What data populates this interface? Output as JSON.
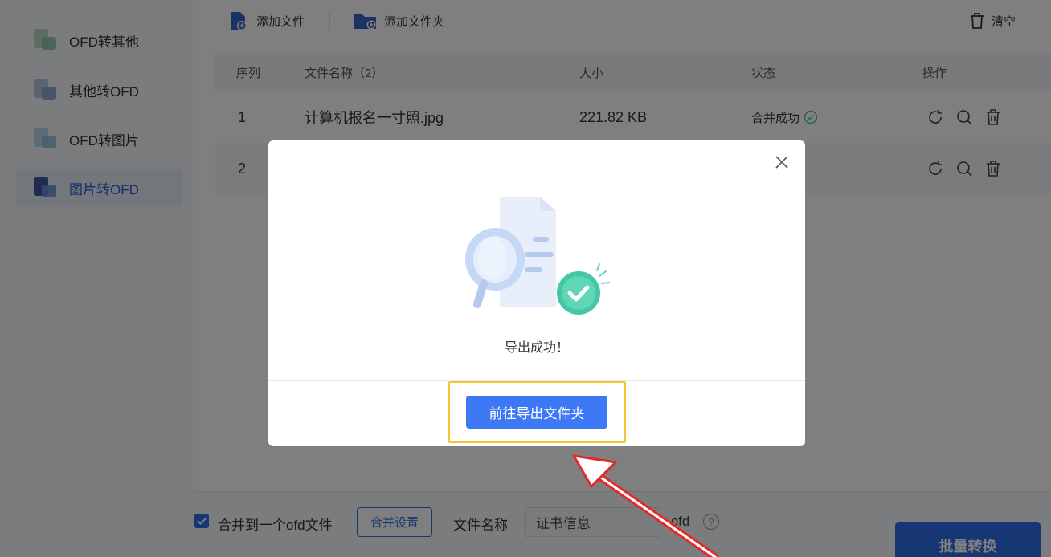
{
  "sidebar": {
    "items": [
      {
        "label": "OFD转其他",
        "icon": "ofd-to-other-icon"
      },
      {
        "label": "其他转OFD",
        "icon": "other-to-ofd-icon"
      },
      {
        "label": "OFD转图片",
        "icon": "ofd-to-image-icon"
      },
      {
        "label": "图片转OFD",
        "icon": "image-to-ofd-icon",
        "active": true
      }
    ]
  },
  "toolbar": {
    "add_file": "添加文件",
    "add_folder": "添加文件夹",
    "clear": "清空"
  },
  "table": {
    "headers": {
      "index": "序列",
      "name": "文件名称（2）",
      "size": "大小",
      "status": "状态",
      "actions": "操作"
    },
    "rows": [
      {
        "index": "1",
        "name": "计算机报名一寸照.jpg",
        "size": "221.82 KB",
        "status": "合并成功"
      },
      {
        "index": "2",
        "name": "",
        "size": "",
        "status": ""
      }
    ]
  },
  "bottom": {
    "merge_label": "合并到一个ofd文件",
    "merge_settings": "合并设置",
    "filename_label": "文件名称",
    "filename_value": "证书信息",
    "extension": ".ofd",
    "help": "?",
    "batch_convert": "批量转换"
  },
  "modal": {
    "message": "导出成功！",
    "go_button": "前往导出文件夹"
  },
  "colors": {
    "accent": "#2f6fe8",
    "success": "#3bc28f",
    "highlight": "#f3c63c",
    "arrow": "#e02b2b"
  }
}
